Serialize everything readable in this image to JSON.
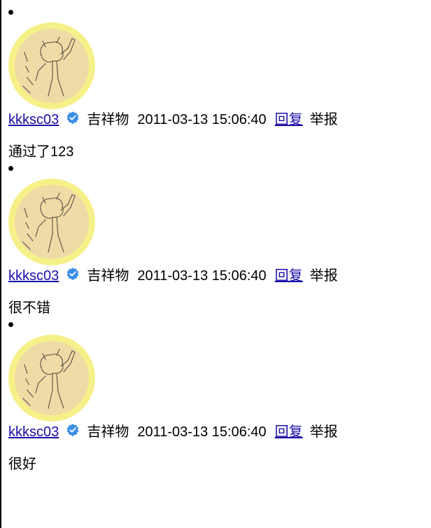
{
  "colors": {
    "link": "#1a0dab",
    "verified_badge": "#3a8ee6",
    "avatar_ring": "#f6f089",
    "avatar_fill": "#efdba6"
  },
  "comments": [
    {
      "username": "kkksc03",
      "badge_icon": "verified-badge-icon",
      "level": "吉祥物",
      "time": "2011-03-13 15:06:40",
      "reply_label": "回复",
      "report_label": "举报",
      "content": "通过了123"
    },
    {
      "username": "kkksc03",
      "badge_icon": "verified-badge-icon",
      "level": "吉祥物",
      "time": "2011-03-13 15:06:40",
      "reply_label": "回复",
      "report_label": "举报",
      "content": "很不错"
    },
    {
      "username": "kkksc03",
      "badge_icon": "verified-badge-icon",
      "level": "吉祥物",
      "time": "2011-03-13 15:06:40",
      "reply_label": "回复",
      "report_label": "举报",
      "content": "很好"
    }
  ]
}
